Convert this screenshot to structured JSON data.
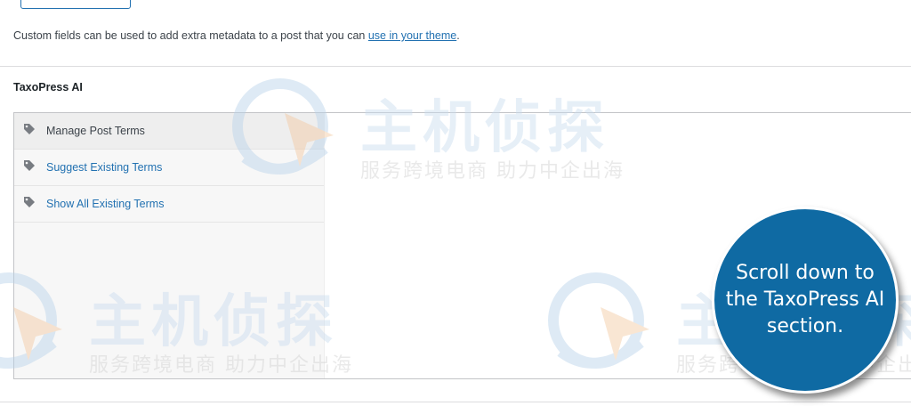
{
  "custom_fields": {
    "description_prefix": "Custom fields can be used to add extra metadata to a post that you can ",
    "description_link": "use in your theme",
    "description_suffix": "."
  },
  "taxopress": {
    "section_title": "TaxoPress AI",
    "nav_items": [
      {
        "label": "Manage Post Terms",
        "active": true,
        "icon": "tag-icon"
      },
      {
        "label": "Suggest Existing Terms",
        "active": false,
        "icon": "tag-icon"
      },
      {
        "label": "Show All Existing Terms",
        "active": false,
        "icon": "tag-icon"
      }
    ]
  },
  "callout": {
    "text": "Scroll down to the TaxoPress AI section."
  },
  "watermark": {
    "main_text": "主机侦探",
    "sub_text": "服务跨境电商 助力中企出海"
  },
  "colors": {
    "link": "#2271b1",
    "callout_bg": "#0f6aa3",
    "border": "#c3c4c7"
  }
}
